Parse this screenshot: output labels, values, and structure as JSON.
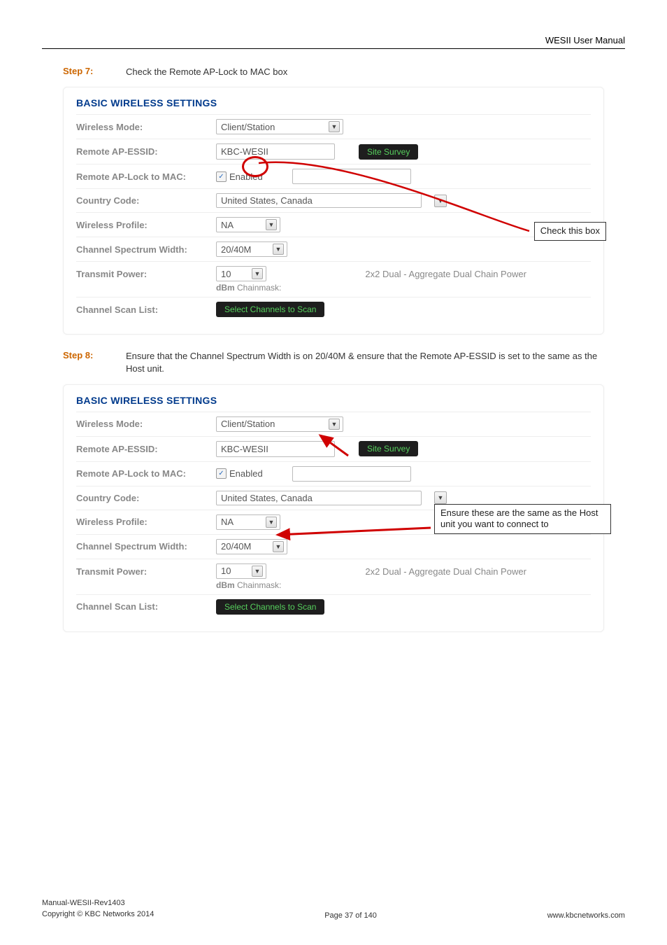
{
  "header": {
    "title": "WESII User Manual"
  },
  "step7": {
    "label": "Step 7:",
    "text": "Check the Remote AP-Lock to MAC box"
  },
  "step8": {
    "label": "Step 8:",
    "text": "Ensure that the Channel Spectrum Width is on 20/40M & ensure that the Remote AP-ESSID is set to the same as the Host unit."
  },
  "panel": {
    "title": "BASIC WIRELESS SETTINGS",
    "labels": {
      "wireless_mode": "Wireless Mode:",
      "remote_essid": "Remote AP-ESSID:",
      "remote_lock": "Remote AP-Lock to MAC:",
      "country": "Country Code:",
      "profile": "Wireless Profile:",
      "spectrum": "Channel Spectrum Width:",
      "tx_power": "Transmit Power:",
      "scan_list": "Channel Scan List:"
    },
    "values": {
      "wireless_mode": "Client/Station",
      "remote_essid": "KBC-WESII",
      "site_survey_btn": "Site Survey",
      "enabled": "Enabled",
      "country": "United States, Canada",
      "profile": "NA",
      "spectrum": "20/40M",
      "tx_power": "10",
      "tx_power_unit": "dBm",
      "chainmask_label": "Chainmask:",
      "tx_power_note": "2x2 Dual - Aggregate Dual Chain Power",
      "scan_btn": "Select Channels to Scan"
    }
  },
  "callouts": {
    "check_box": "Check this box",
    "ensure": "Ensure these are the same as the Host unit you want to connect to"
  },
  "footer": {
    "l1": "Manual-WESII-Rev1403",
    "l2": "Copyright © KBC Networks 2014",
    "center": "Page 37 of 140",
    "right": "www.kbcnetworks.com"
  }
}
